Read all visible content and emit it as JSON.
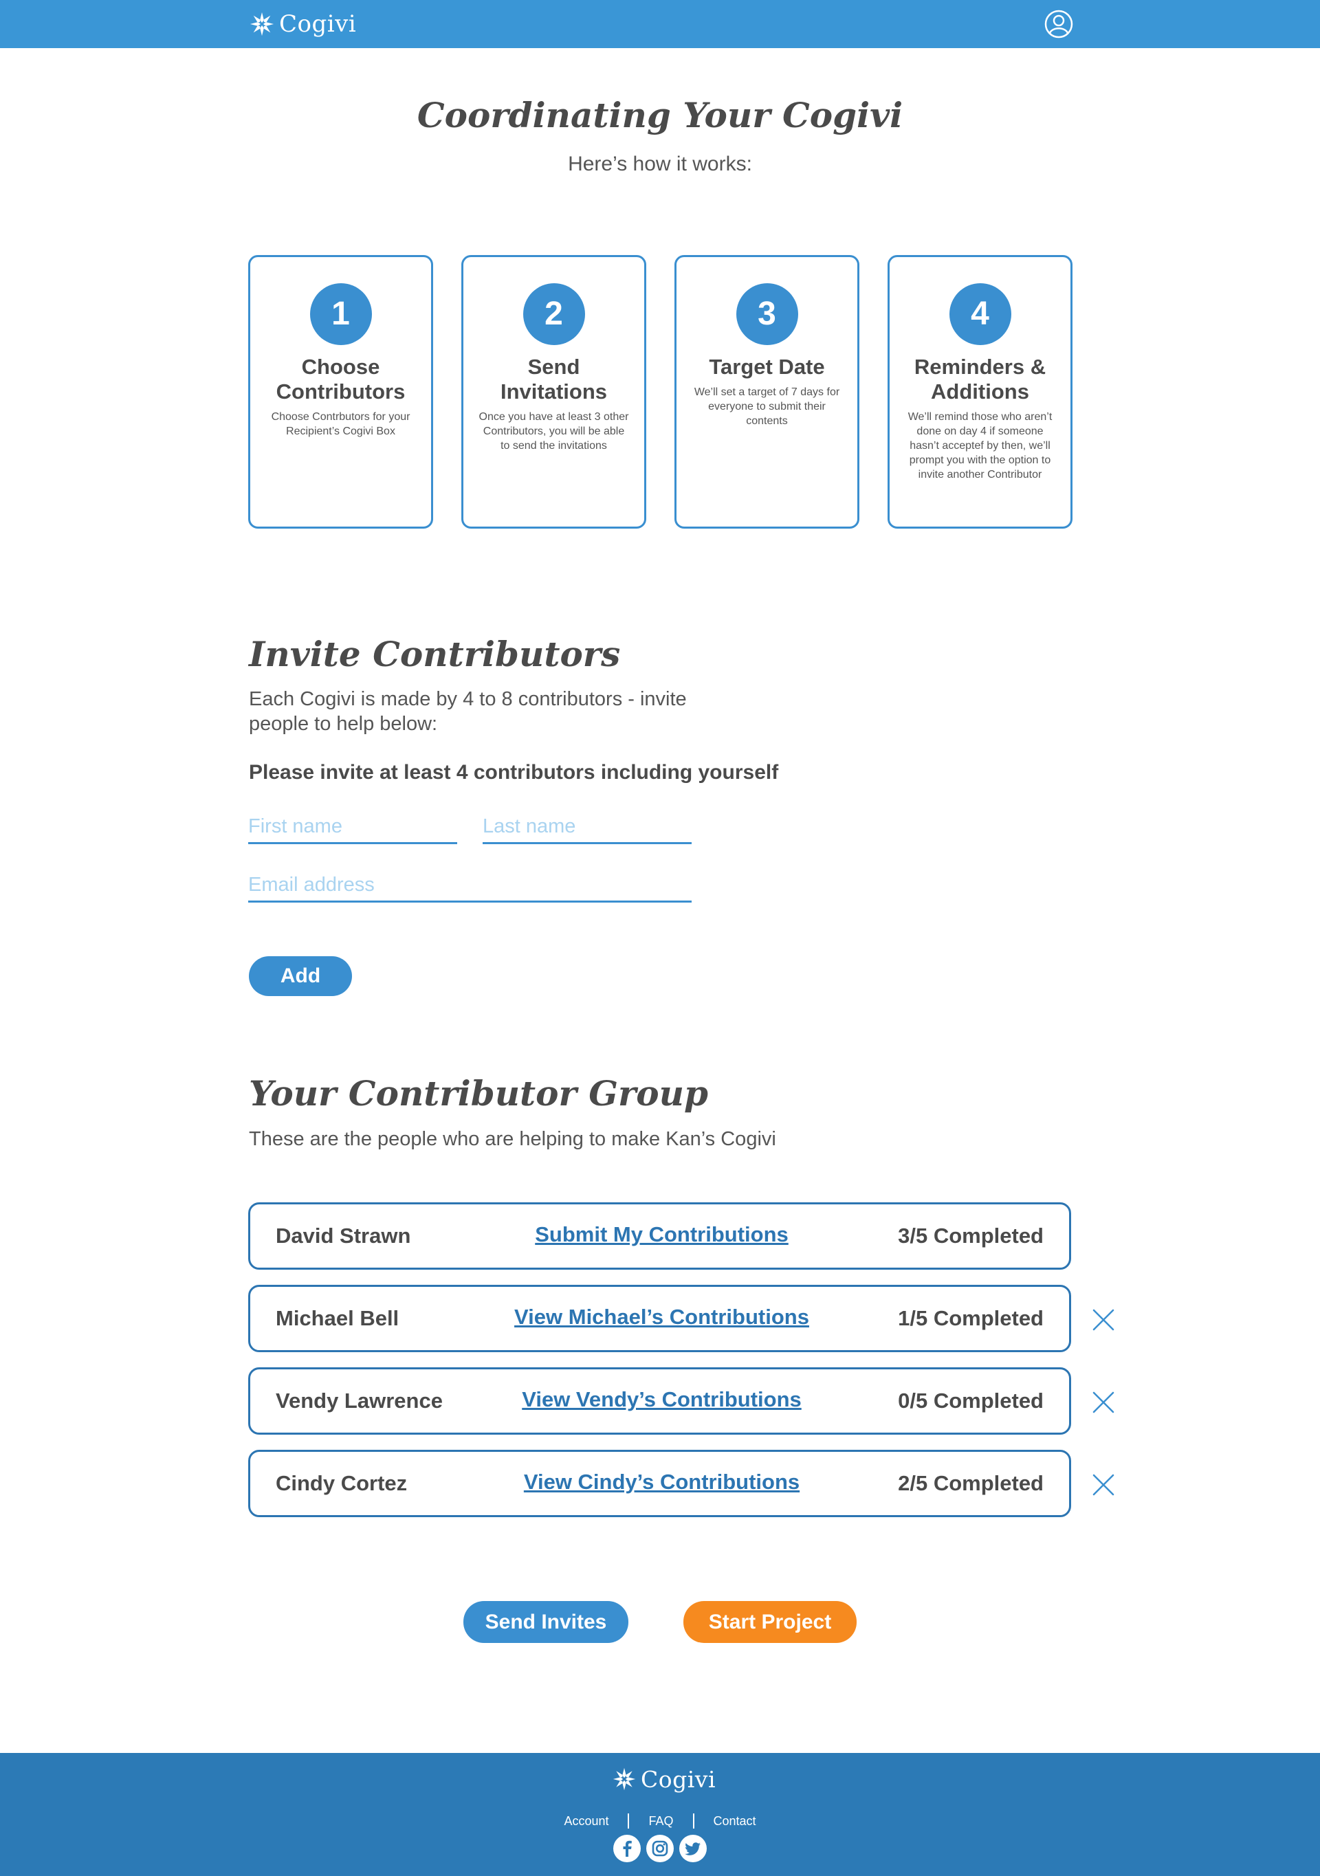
{
  "header": {
    "brand": "Cogivi",
    "logo_icon": "snowflake-logo-icon",
    "user_icon": "user-account-icon"
  },
  "hero": {
    "title": "Coordinating Your Cogivi",
    "subtitle": "Here’s how it works:"
  },
  "steps": [
    {
      "number": "1",
      "title": "Choose Contributors",
      "desc": "Choose Contrbutors for your Recipient’s Cogivi Box"
    },
    {
      "number": "2",
      "title": "Send Invitations",
      "desc": "Once you have at least 3 other Contributors, you will be able to send the invitations"
    },
    {
      "number": "3",
      "title": "Target Date",
      "desc": "We’ll set a target of 7 days for everyone to submit their contents"
    },
    {
      "number": "4",
      "title": "Reminders & Additions",
      "desc": "We’ll remind those who aren’t done on day 4 if someone hasn’t acceptef by then, we’ll prompt you with the option to invite another Contributor"
    }
  ],
  "invite": {
    "title": "Invite Contributors",
    "text": "Each Cogivi is made by 4 to 8 contributors - invite people to help below:",
    "note": "Please invite at least 4 contributors including yourself",
    "first_name_placeholder": "First name",
    "last_name_placeholder": "Last name",
    "email_placeholder": "Email address",
    "add_label": "Add"
  },
  "group": {
    "title": "Your Contributor Group",
    "text": "These are the people who are helping to make Kan’s Cogivi",
    "rows": [
      {
        "name": "David Strawn",
        "link": "Submit My Contributions",
        "status": "3/5 Completed",
        "removable": false
      },
      {
        "name": "Michael Bell",
        "link": "View Michael’s Contributions",
        "status": "1/5 Completed",
        "removable": true
      },
      {
        "name": "Vendy Lawrence",
        "link": "View Vendy’s Contributions",
        "status": "0/5 Completed",
        "removable": true
      },
      {
        "name": "Cindy Cortez",
        "link": "View Cindy’s Contributions",
        "status": "2/5 Completed",
        "removable": true
      }
    ],
    "remove_icon": "close-icon"
  },
  "actions": {
    "send_label": "Send Invites",
    "start_label": "Start Project"
  },
  "footer": {
    "brand": "Cogivi",
    "links": [
      "Account",
      "FAQ",
      "Contact"
    ],
    "socials": [
      "facebook-icon",
      "instagram-icon",
      "twitter-icon"
    ]
  },
  "colors": {
    "primary": "#3a96d6",
    "border": "#2c75b2",
    "accent": "#f68a1f",
    "footer": "#2c7ab6"
  }
}
